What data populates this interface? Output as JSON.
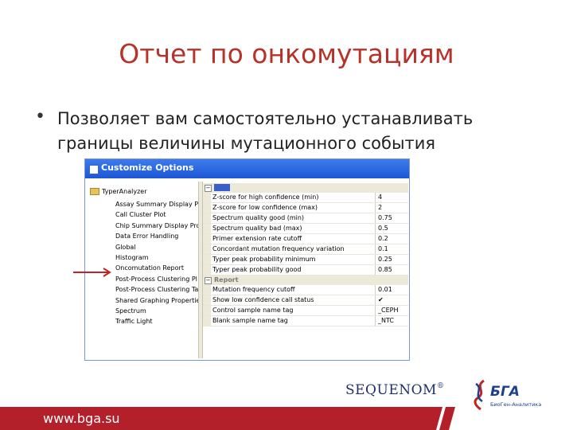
{
  "slide": {
    "title": "Отчет по онкомутациям",
    "bullet": "Позволяет вам самостоятельно устанавливать границы величины мутационного события"
  },
  "window": {
    "title": "Customize Options",
    "tree_root": "TyperAnalyzer",
    "tree_items": [
      "Assay Summary Display Pr",
      "Call Cluster Plot",
      "Chip Summary Display Pro",
      "Data Error Handling",
      "Global",
      "Histogram",
      "Oncomutation Report",
      "Post-Process Clustering Pl",
      "Post-Process Clustering Ta",
      "Shared Graphing Propertie",
      "Spectrum",
      "Traffic Light"
    ],
    "categories": [
      {
        "label": "",
        "properties": [
          {
            "name": "Z-score for high confidence (min)",
            "value": "4"
          },
          {
            "name": "Z-score for low confidence (max)",
            "value": "2"
          },
          {
            "name": "Spectrum quality good (min)",
            "value": "0.75"
          },
          {
            "name": "Spectrum quality bad (max)",
            "value": "0.5"
          },
          {
            "name": "Primer extension rate cutoff",
            "value": "0.2"
          },
          {
            "name": "Concordant mutation frequency variation",
            "value": "0.1"
          },
          {
            "name": "Typer peak probability minimum",
            "value": "0.25"
          },
          {
            "name": "Typer peak probability good",
            "value": "0.85"
          }
        ]
      },
      {
        "label": "Report",
        "properties": [
          {
            "name": "Mutation frequency cutoff",
            "value": "0.01"
          },
          {
            "name": "Show low confidence call status",
            "value": "✔"
          },
          {
            "name": "Control sample name tag",
            "value": "_CEPH"
          },
          {
            "name": "Blank sample name tag",
            "value": "_NTC"
          }
        ]
      }
    ]
  },
  "brand": {
    "sequenom": "SEQUENOM",
    "sequenom_mark": "®",
    "bga": "БГА",
    "bga_sub": "БиоГен-Аналитика"
  },
  "footer": {
    "url": "www.bga.su"
  },
  "colors": {
    "title": "#b8322a",
    "footer": "#b3202a",
    "accent_blue": "#1f3e8c"
  }
}
